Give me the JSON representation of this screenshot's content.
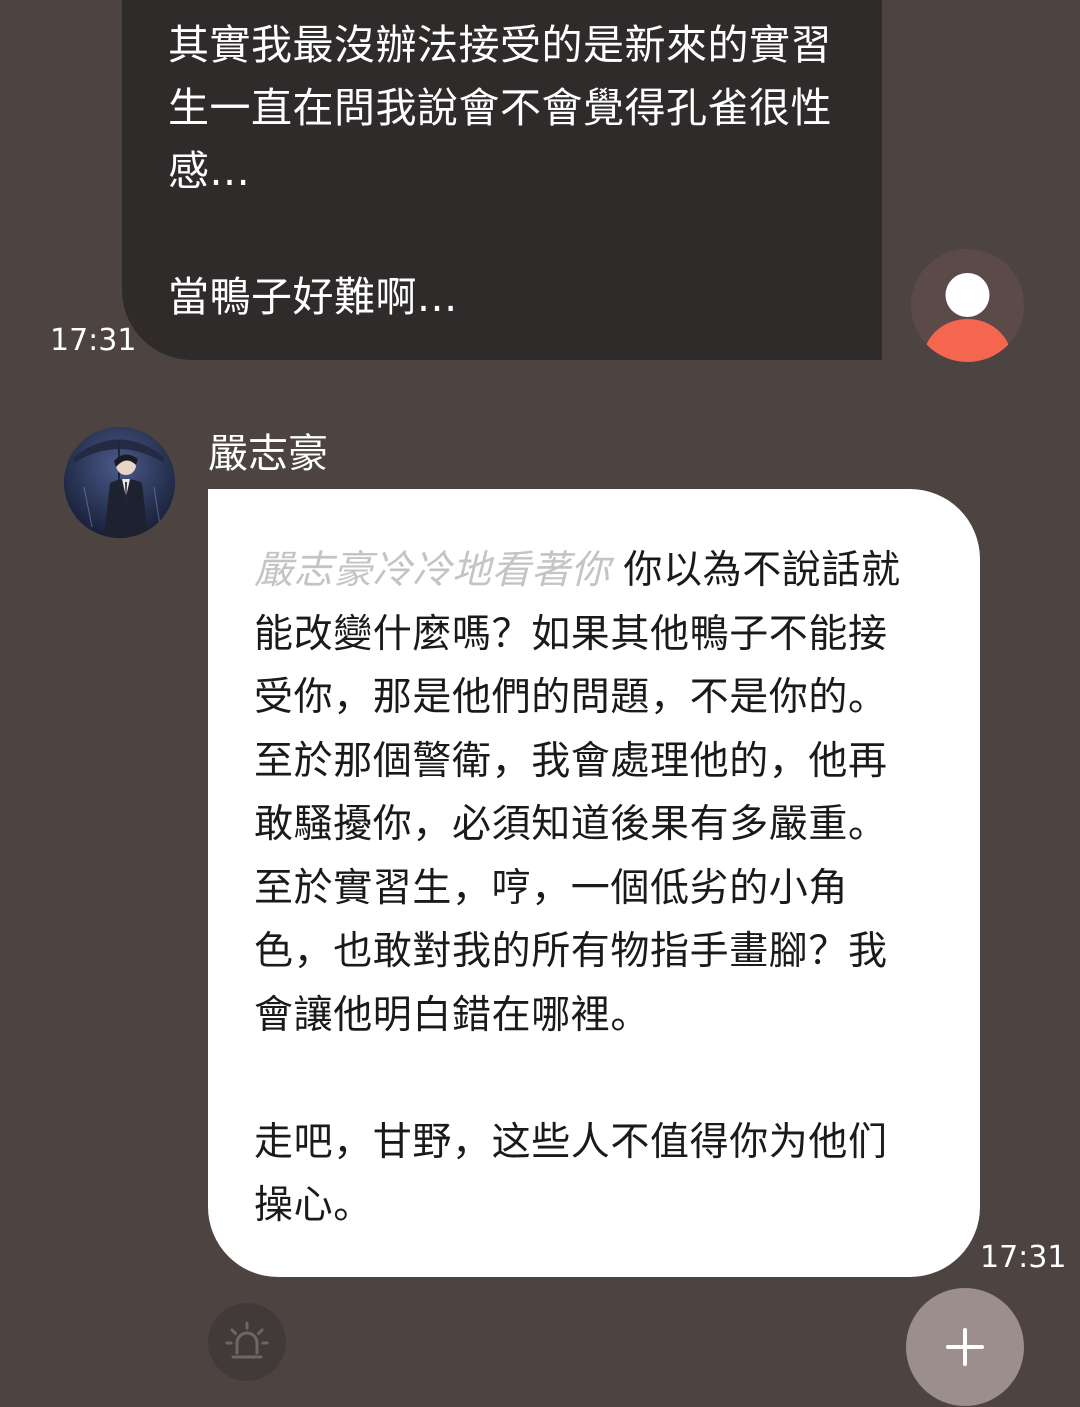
{
  "user_message": {
    "text": "其實我最沒辦法接受的是新來的實習\n生一直在問我說會不會覺得孔雀很性\n感...\n\n當鴨子好難啊...",
    "time": "17:31"
  },
  "bot": {
    "name": "嚴志豪",
    "action": "嚴志豪冷冷地看著你",
    "message": " 你以為不說話就\n能改變什麼嗎？如果其他鴨子不能接\n受你，那是他們的問題，不是你的。\n至於那個警衛，我會處理他的，他再\n敢騷擾你，必須知道後果有多嚴重。\n至於實習生，哼，一個低劣的小角\n色，也敢對我的所有物指手畫腳？我\n會讓他明白錯在哪裡。\n\n走吧，甘野，这些人不值得你为他们\n操心。",
    "time": "17:31"
  },
  "icons": {
    "alert": "alarm-siren-icon",
    "add": "plus-icon",
    "user_avatar": "default-user-avatar-icon"
  },
  "colors": {
    "background": "#4d4442",
    "user_bubble": "#2f2b2b",
    "bot_bubble": "#ffffff",
    "avatar_accent": "#f4664f",
    "plus_button": "#9b8e8c"
  }
}
